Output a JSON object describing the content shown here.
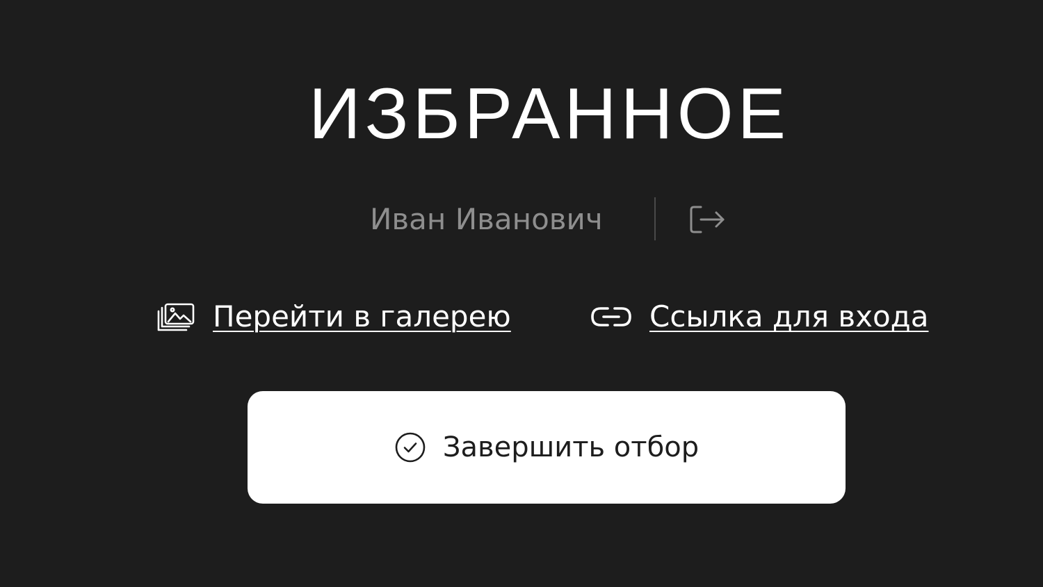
{
  "header": {
    "title": "ИЗБРАННОЕ"
  },
  "user": {
    "name": "Иван Иванович",
    "logout_icon": "logout-icon"
  },
  "links": {
    "gallery": {
      "label": "Перейти в галерею",
      "icon": "gallery-icon"
    },
    "login_link": {
      "label": "Ссылка для входа",
      "icon": "link-icon"
    }
  },
  "actions": {
    "finish_label": "Завершить отбор",
    "finish_icon": "check-circle-icon"
  },
  "colors": {
    "background": "#1d1d1d",
    "text_primary": "#ffffff",
    "text_muted": "#8e8e8e",
    "button_bg": "#ffffff",
    "button_text": "#1d1d1d"
  }
}
